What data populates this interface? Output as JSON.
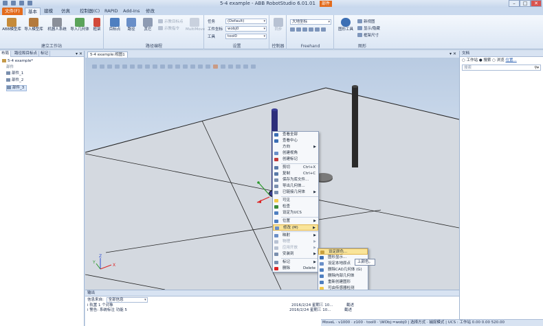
{
  "window": {
    "title": "5-4 example - ABB RobotStudio 6.01.01",
    "badge": "部件"
  },
  "menu_tabs": [
    {
      "label": "文件(F)"
    },
    {
      "label": "基本"
    },
    {
      "label": "建模"
    },
    {
      "label": "仿真"
    },
    {
      "label": "控制器(C)"
    },
    {
      "label": "RAPID"
    },
    {
      "label": "Add-Ins"
    },
    {
      "label": "修改"
    }
  ],
  "ribbon": {
    "group_build": {
      "label": "建立工作站",
      "abb_library": "ABB模型库",
      "import_library": "导入模型库",
      "robot_system": "机器人系统",
      "import_geometry": "导入几何体",
      "frame": "框架"
    },
    "group_path": {
      "label": "路径编程",
      "target": "目标点",
      "path": "路径",
      "other": "其它",
      "teach_target": "示教目标点",
      "teach_instruction": "示教指令",
      "multimove": "MultiMove"
    },
    "group_settings": {
      "label": "设置",
      "task_label": "任务",
      "task_value": "(Default)",
      "wobj_label": "工件坐标",
      "wobj_value": "wobj0",
      "tool_label": "工具",
      "tool_value": "tool0"
    },
    "group_controller": {
      "label": "控制器",
      "sync": "同步"
    },
    "group_freehand": {
      "label": "Freehand",
      "coord_value": "大地坐标"
    },
    "group_graphics": {
      "label": "图形",
      "graphics_tools": "图形工具",
      "new_view": "新视图",
      "show_hide": "显示/隐藏",
      "frame_size": "框架尺寸"
    }
  },
  "left_panel": {
    "tabs": [
      "布局",
      "路径和目标点",
      "标记"
    ],
    "root": "5-4 example*",
    "section": "部件",
    "parts": [
      "部件_1",
      "部件_2",
      "部件_3"
    ]
  },
  "viewport": {
    "tab": "5-4 example:视图1",
    "axis_x": "X",
    "axis_y": "Y",
    "axis_z": "Z"
  },
  "context_menu": {
    "items": [
      {
        "label": "查看全部"
      },
      {
        "label": "查看中心"
      },
      {
        "label": "方向",
        "sub": true
      },
      {
        "label": "创建视角"
      },
      {
        "label": "创建标记"
      },
      {
        "sep": true
      },
      {
        "label": "剪切",
        "shortcut": "Ctrl+X"
      },
      {
        "label": "复制",
        "shortcut": "Ctrl+C"
      },
      {
        "label": "保存为库文件..."
      },
      {
        "label": "导出几何体..."
      },
      {
        "label": "已链接几何体",
        "sub": true
      },
      {
        "sep": true
      },
      {
        "label": "可见",
        "checked": true
      },
      {
        "label": "检查"
      },
      {
        "label": "设定为UCS"
      },
      {
        "sep": true
      },
      {
        "label": "位置",
        "sub": true
      },
      {
        "label": "修改 (M)",
        "sub": true,
        "selected": true
      },
      {
        "sep": true
      },
      {
        "label": "映射",
        "sub": true
      },
      {
        "label": "物理",
        "sub": true,
        "disabled": true
      },
      {
        "label": "应用开放",
        "sub": true,
        "disabled": true
      },
      {
        "label": "安装到",
        "sub": true
      },
      {
        "sep": true
      },
      {
        "label": "标记",
        "sub": true
      },
      {
        "label": "删除",
        "shortcut": "Delete"
      }
    ]
  },
  "submenu": {
    "items": [
      "设定颜色...",
      "图形显示...",
      "设定本地原点",
      "删除CAD几何体 (G)",
      "删除内部几何体",
      "重新创建图形",
      "可由传感器检测"
    ],
    "tooltip": "上颜色。"
  },
  "output": {
    "title": "输出",
    "filter_label": "信息来自:",
    "filter_value": "全部信息",
    "rows": [
      {
        "text": "i 轨置 1 个对象",
        "date": "2016/2/24 星期三 10...",
        "cat": "截述"
      },
      {
        "text": "i 警告: 系统标注 功能 5",
        "date": "2016/2/24 星期三 10...",
        "cat": "截述"
      }
    ]
  },
  "right_panel": {
    "title": "文档",
    "radio_workstation": "工作站",
    "radio_search": "搜索",
    "radio_browse": "浏览",
    "location_link": "位置...",
    "search_placeholder": "搜索"
  },
  "status": {
    "text": "MoveL · v1000 · z100 · tool0 · \\WObj:=wobj0 | 选择方式 · 捕捉模式 | UCS : 工作站  0.00  0.00  520.00"
  },
  "colors": {
    "accent": "#e36b1c",
    "menu_highlight": "#f9e49a"
  }
}
